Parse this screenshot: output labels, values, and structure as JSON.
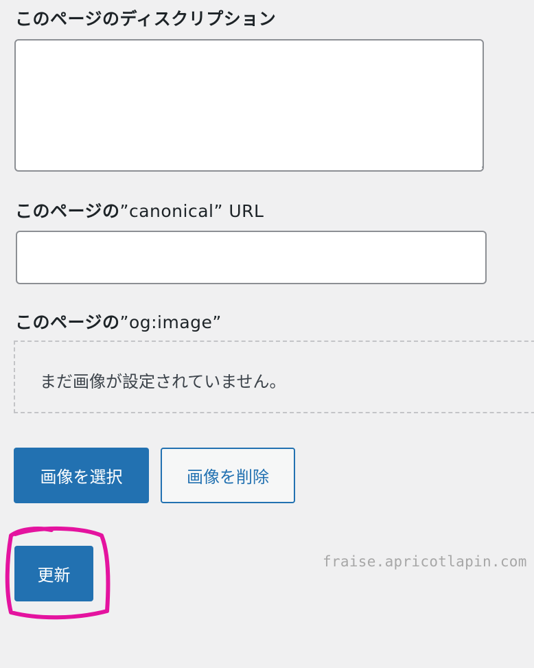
{
  "description": {
    "label_jp": "このページのディスクリプション",
    "value": ""
  },
  "canonical": {
    "label_jp": "このページの",
    "label_latin": "”canonical” URL",
    "value": ""
  },
  "og_image": {
    "label_jp": "このページの",
    "label_latin": "”og:image”",
    "empty_text": "まだ画像が設定されていません。",
    "select_button": "画像を選択",
    "delete_button": "画像を削除"
  },
  "update_button": "更新",
  "watermark": "fraise.apricotlapin.com",
  "colors": {
    "background": "#f0f0f1",
    "primary": "#2271b1",
    "highlight": "#e4139f"
  }
}
